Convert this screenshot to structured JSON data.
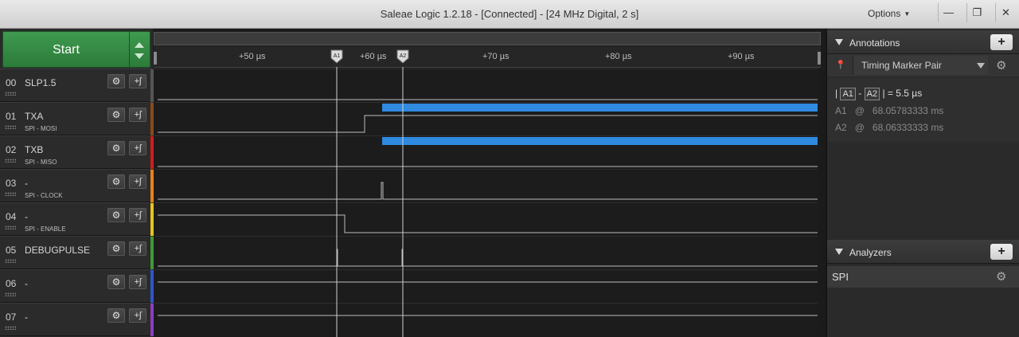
{
  "window": {
    "title": "Saleae Logic 1.2.18 - [Connected] - [24 MHz Digital, 2 s]",
    "options_label": "Options",
    "minimize_symbol": "—",
    "restore_symbol": "❐",
    "close_symbol": "✕"
  },
  "start_button": {
    "label": "Start"
  },
  "channels": [
    {
      "num": "00",
      "name": "SLP1.5",
      "sub": "",
      "color": "#555555"
    },
    {
      "num": "01",
      "name": "TXA",
      "sub": "SPI - MOSI",
      "color": "#8a4a1a"
    },
    {
      "num": "02",
      "name": "TXB",
      "sub": "SPI - MISO",
      "color": "#d11c1c"
    },
    {
      "num": "03",
      "name": "-",
      "sub": "SPI - CLOCK",
      "color": "#e8821a"
    },
    {
      "num": "04",
      "name": "-",
      "sub": "SPI - ENABLE",
      "color": "#e7c41a"
    },
    {
      "num": "05",
      "name": "DEBUGPULSE",
      "sub": "",
      "color": "#3d9a35"
    },
    {
      "num": "06",
      "name": "-",
      "sub": "",
      "color": "#2f56c9"
    },
    {
      "num": "07",
      "name": "-",
      "sub": "",
      "color": "#8e3cc4"
    }
  ],
  "channel_buttons": {
    "gear_symbol": "⚙",
    "trigger_symbol": "+ʃ"
  },
  "ruler": {
    "ticks": [
      "+50 µs",
      "+60 µs",
      "+70 µs",
      "+80 µs",
      "+90 µs"
    ],
    "marker_a1": "A1",
    "marker_a2": "A2"
  },
  "annotations": {
    "title": "Annotations",
    "add_symbol": "+",
    "marker_pair_label": "Timing Marker Pair",
    "delta": {
      "a": "A1",
      "b": "A2",
      "value": "5.5 µs",
      "bar": "|",
      "dash": "-",
      "eq": "="
    },
    "a1": {
      "label": "A1",
      "at": "@",
      "time": "68.05783333 ms"
    },
    "a2": {
      "label": "A2",
      "at": "@",
      "time": "68.06333333 ms"
    }
  },
  "analyzers": {
    "title": "Analyzers",
    "add_symbol": "+",
    "items": [
      {
        "name": "SPI"
      }
    ]
  },
  "colors": {
    "spi_data": "#2f8ae0",
    "trace": "#bdbdbd",
    "start_green": "#2c7b3a"
  }
}
